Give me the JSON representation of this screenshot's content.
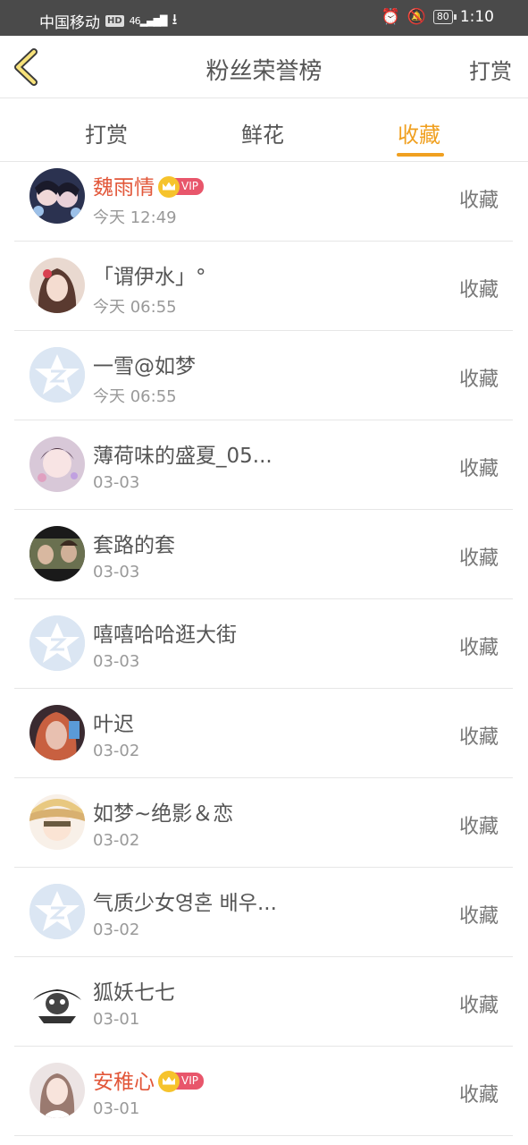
{
  "status_bar": {
    "carrier": "中国移动",
    "hd": "HD",
    "network": "46",
    "battery": "80",
    "time": "1:10"
  },
  "nav": {
    "title": "粉丝荣誉榜",
    "action": "打赏"
  },
  "tabs": [
    {
      "label": "打赏"
    },
    {
      "label": "鲜花"
    },
    {
      "label": "收藏",
      "active": true
    }
  ],
  "accent_color": "#f0a020",
  "vip_name_color": "#e2573a",
  "list": [
    {
      "name": "魏雨情",
      "vip": "VIP",
      "time": "今天 12:49",
      "action": "收藏",
      "avatar": "photo-anime-girls"
    },
    {
      "name": "「谓伊水」°",
      "time": "今天 06:55",
      "action": "收藏",
      "avatar": "photo-girl"
    },
    {
      "name": "一雪@如梦",
      "time": "今天 06:55",
      "action": "收藏",
      "avatar": "default-avatar-icon"
    },
    {
      "name": "薄荷味的盛夏_05...",
      "time": "03-03",
      "action": "收藏",
      "avatar": "photo-child"
    },
    {
      "name": "套路的套",
      "time": "03-03",
      "action": "收藏",
      "avatar": "photo-couple"
    },
    {
      "name": "嘻嘻哈哈逛大街",
      "time": "03-03",
      "action": "收藏",
      "avatar": "default-avatar-icon"
    },
    {
      "name": "叶迟",
      "time": "03-02",
      "action": "收藏",
      "avatar": "photo-woman"
    },
    {
      "name": "如梦~绝影＆恋",
      "time": "03-02",
      "action": "收藏",
      "avatar": "photo-anime"
    },
    {
      "name": "气质少女영혼 배우...",
      "time": "03-02",
      "action": "收藏",
      "avatar": "default-avatar-icon"
    },
    {
      "name": "狐妖七七",
      "time": "03-01",
      "action": "收藏",
      "avatar": "photo-bw-art"
    },
    {
      "name": "安稚心",
      "vip": "VIP",
      "time": "03-01",
      "action": "收藏",
      "avatar": "photo-girl-2"
    }
  ]
}
